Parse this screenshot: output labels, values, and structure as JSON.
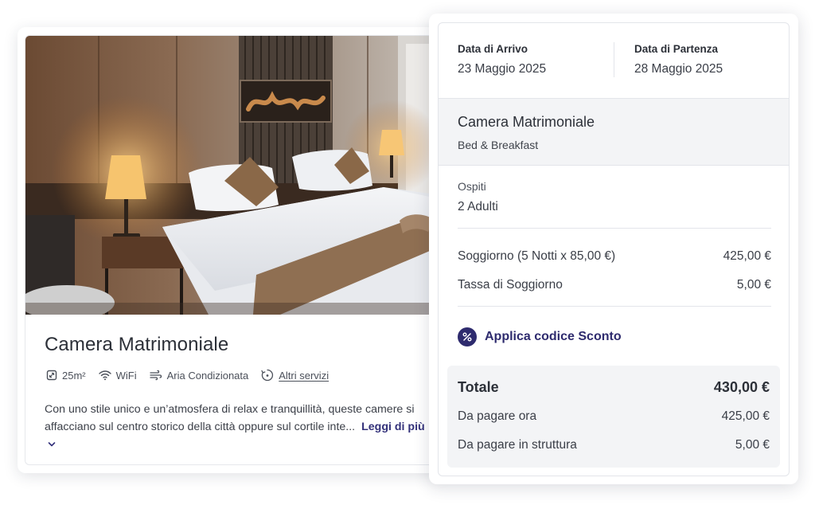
{
  "room_card": {
    "title": "Camera Matrimoniale",
    "amenities": [
      {
        "icon": "area-icon",
        "label": "25m²"
      },
      {
        "icon": "wifi-icon",
        "label": "WiFi"
      },
      {
        "icon": "air-conditioning-icon",
        "label": "Aria Condizionata"
      },
      {
        "icon": "more-services-icon",
        "label": "Altri servizi"
      }
    ],
    "description": "Con uno stile unico e un’atmosfera di relax e tranquillità, queste camere si affacciano sul centro storico della città oppure sul cortile inte...",
    "read_more": "Leggi di più"
  },
  "summary": {
    "arrival_label": "Data di Arrivo",
    "arrival_date": "23 Maggio 2025",
    "departure_label": "Data di Partenza",
    "departure_date": "28 Maggio 2025",
    "room_name": "Camera Matrimoniale",
    "board": "Bed & Breakfast",
    "guests_label": "Ospiti",
    "guests_value": "2 Adulti",
    "stay_label": "Soggiorno (5 Notti x 85,00 €)",
    "stay_amount": "425,00 €",
    "tax_label": "Tassa di Soggiorno",
    "tax_amount": "5,00 €",
    "discount_label": "Applica codice Sconto",
    "total_label": "Totale",
    "total_amount": "430,00 €",
    "pay_now_label": "Da pagare ora",
    "pay_now_amount": "425,00 €",
    "pay_property_label": "Da pagare in struttura",
    "pay_property_amount": "5,00 €"
  },
  "colors": {
    "accent": "#2e2b6e",
    "panel_bg": "#f3f4f6",
    "border": "#e3e5ea"
  }
}
